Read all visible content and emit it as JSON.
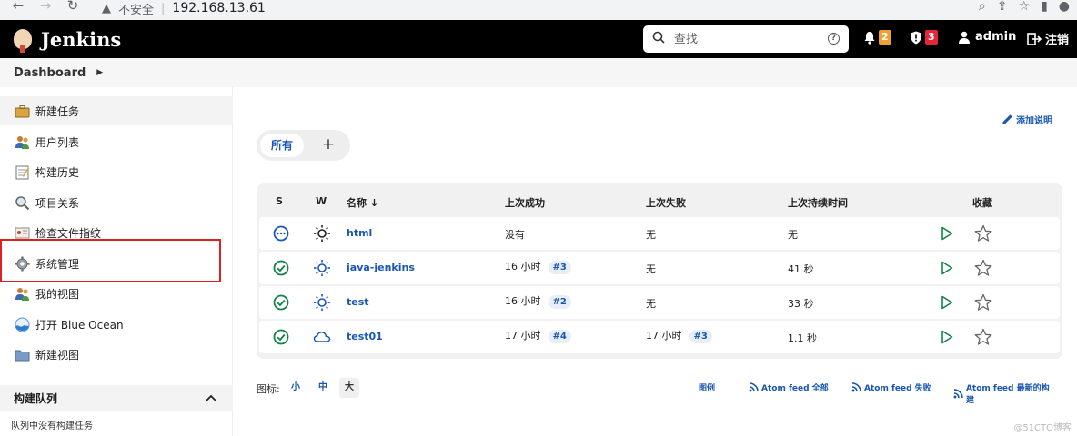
{
  "browser": {
    "security_label": "不安全",
    "url": "192.168.13.61"
  },
  "header": {
    "app_name": "Jenkins",
    "search_placeholder": "查找",
    "notifications_count": "2",
    "security_count": "3",
    "user": "admin",
    "logout": "注销"
  },
  "breadcrumb": {
    "root": "Dashboard"
  },
  "sidebar": {
    "items": [
      {
        "label": "新建任务",
        "icon": "briefcase-icon"
      },
      {
        "label": "用户列表",
        "icon": "users-icon"
      },
      {
        "label": "构建历史",
        "icon": "notepad-icon"
      },
      {
        "label": "项目关系",
        "icon": "magnifier-icon"
      },
      {
        "label": "检查文件指纹",
        "icon": "fingerprint-icon"
      },
      {
        "label": "系统管理",
        "icon": "gear-icon"
      },
      {
        "label": "我的视图",
        "icon": "users-icon"
      },
      {
        "label": "打开 Blue Ocean",
        "icon": "blue-ocean-icon"
      },
      {
        "label": "新建视图",
        "icon": "folder-icon"
      }
    ],
    "queue_title": "构建队列",
    "queue_empty": "队列中没有构建任务"
  },
  "main": {
    "add_description": "添加说明",
    "tabs": [
      {
        "label": "所有"
      }
    ],
    "add_tab": "+",
    "columns": {
      "s": "S",
      "w": "W",
      "name": "名称 ↓",
      "last_success": "上次成功",
      "last_failure": "上次失败",
      "last_duration": "上次持续时间",
      "favorite": "收藏"
    },
    "jobs": [
      {
        "status": "not-built",
        "weather": "sunny",
        "name": "html",
        "last_success": "没有",
        "last_success_build": "",
        "last_failure": "无",
        "last_failure_build": "",
        "duration": "无"
      },
      {
        "status": "success",
        "weather": "sunny",
        "name": "java-jenkins",
        "last_success": "16 小时",
        "last_success_build": "#3",
        "last_failure": "无",
        "last_failure_build": "",
        "duration": "41 秒"
      },
      {
        "status": "success",
        "weather": "sunny",
        "name": "test",
        "last_success": "16 小时",
        "last_success_build": "#2",
        "last_failure": "无",
        "last_failure_build": "",
        "duration": "33 秒"
      },
      {
        "status": "success",
        "weather": "cloudy",
        "name": "test01",
        "last_success": "17 小时",
        "last_success_build": "#4",
        "last_failure": "17 小时",
        "last_failure_build": "#3",
        "duration": "1.1 秒"
      }
    ],
    "footer": {
      "icon_label": "图标:",
      "sizes": [
        "小",
        "中",
        "大"
      ],
      "legend": "图例",
      "feed_all": "Atom feed 全部",
      "feed_failed": "Atom feed 失败",
      "feed_latest": "Atom feed 最新的构建"
    }
  },
  "watermark": "@51CTO博客",
  "colors": {
    "accent": "#1957b2",
    "success": "#138347",
    "header_bg": "#000000",
    "highlight_box": "#e02020"
  }
}
